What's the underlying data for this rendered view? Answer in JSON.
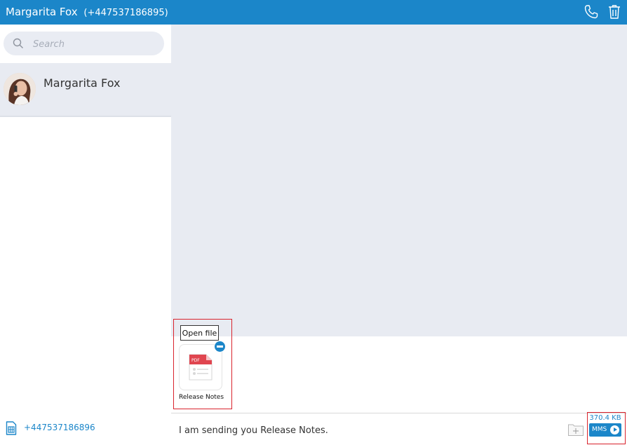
{
  "header": {
    "contact_name": "Margarita Fox",
    "contact_phone": "(+447537186895)",
    "icons": [
      "phone-icon",
      "trash-icon"
    ]
  },
  "sidebar": {
    "search": {
      "placeholder": "Search",
      "value": ""
    },
    "contacts": [
      {
        "name": "Margarita Fox"
      }
    ],
    "own_number": "+447537186896"
  },
  "compose": {
    "tooltip": "Open file",
    "attachment": {
      "name": "Release Notes",
      "type_label": "PDF"
    },
    "message": "I am sending you Release Notes.",
    "size": "370.4 KB",
    "send_label": "MMS"
  },
  "colors": {
    "accent": "#1b86c9",
    "chat_bg": "#e8ebf2",
    "highlight": "#d9232d",
    "pdf": "#e0454f"
  }
}
